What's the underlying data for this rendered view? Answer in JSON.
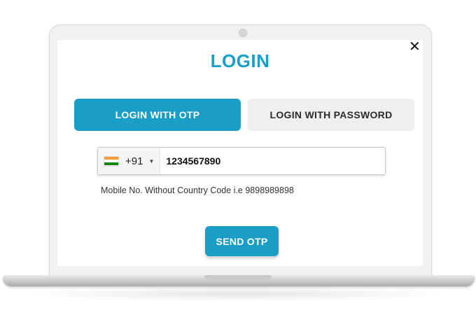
{
  "modal": {
    "title": "LOGIN",
    "close_icon": "close-icon"
  },
  "tabs": [
    {
      "label": "LOGIN WITH OTP",
      "active": true
    },
    {
      "label": "LOGIN WITH PASSWORD",
      "active": false
    }
  ],
  "phone": {
    "country_flag": "india-flag-icon",
    "dial_code": "+91",
    "value": "1234567890",
    "hint": "Mobile No. Without Country Code i.e 9898989898"
  },
  "send_button": {
    "label": "SEND OTP"
  },
  "colors": {
    "accent": "#1a9ec6",
    "title": "#1aa0c8",
    "inactive_tab": "#efefef",
    "flag_saffron": "#ff9933",
    "flag_white": "#ffffff",
    "flag_green": "#138808"
  }
}
